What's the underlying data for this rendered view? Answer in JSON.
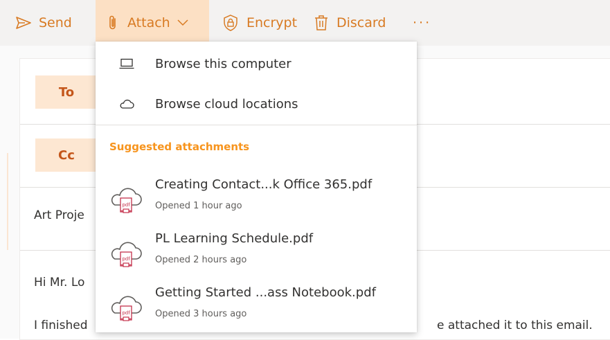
{
  "toolbar": {
    "send_label": "Send",
    "attach_label": "Attach",
    "encrypt_label": "Encrypt",
    "discard_label": "Discard",
    "more_label": "···",
    "accent_color": "#d87a22",
    "attach_active_bg": "#fce0c4"
  },
  "compose": {
    "to_label": "To",
    "cc_label": "Cc",
    "subject_value": "Art Proje",
    "greeting": "Hi Mr. Lo",
    "body_start": "I finished",
    "body_end": "e attached it to this email."
  },
  "attach_menu": {
    "browse_computer_label": "Browse this computer",
    "browse_cloud_label": "Browse cloud locations",
    "suggested_header": "Suggested attachments",
    "suggested": [
      {
        "name": "Creating Contact...k Office 365.pdf",
        "opened": "Opened 1 hour ago",
        "icon": "cloud-pdf-icon"
      },
      {
        "name": "PL Learning Schedule.pdf",
        "opened": "Opened 2 hours ago",
        "icon": "cloud-pdf-icon"
      },
      {
        "name": "Getting Started ...ass Notebook.pdf",
        "opened": "Opened 3 hours ago",
        "icon": "cloud-pdf-icon"
      }
    ]
  }
}
